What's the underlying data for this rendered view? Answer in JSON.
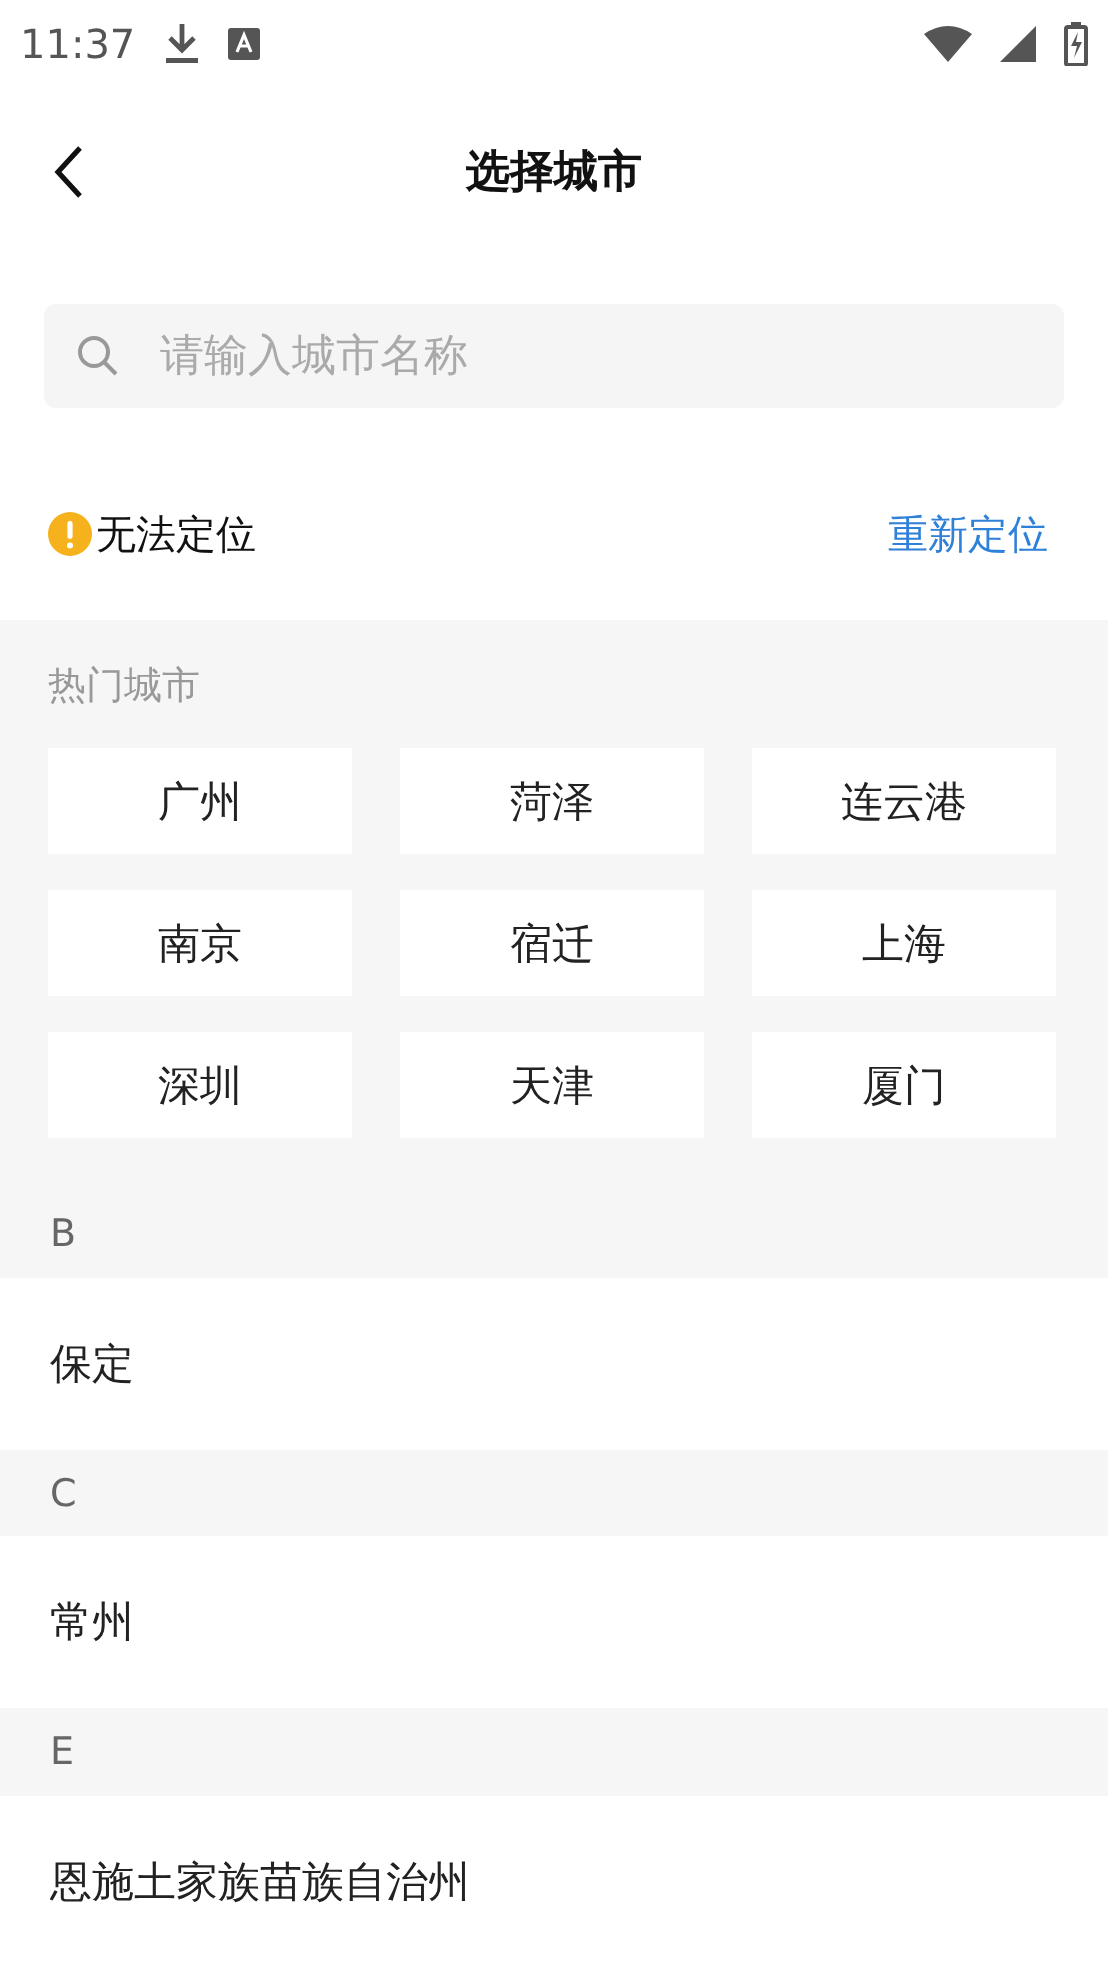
{
  "status_bar": {
    "time": "11:37"
  },
  "header": {
    "title": "选择城市"
  },
  "search": {
    "placeholder": "请输入城市名称"
  },
  "location": {
    "status": "无法定位",
    "action": "重新定位"
  },
  "hot_cities": {
    "title": "热门城市",
    "cities": [
      "广州",
      "菏泽",
      "连云港",
      "南京",
      "宿迁",
      "上海",
      "深圳",
      "天津",
      "厦门"
    ]
  },
  "sections": [
    {
      "letter": "B",
      "cities": [
        "保定"
      ]
    },
    {
      "letter": "C",
      "cities": [
        "常州"
      ]
    },
    {
      "letter": "E",
      "cities": [
        "恩施土家族苗族自治州"
      ]
    }
  ]
}
